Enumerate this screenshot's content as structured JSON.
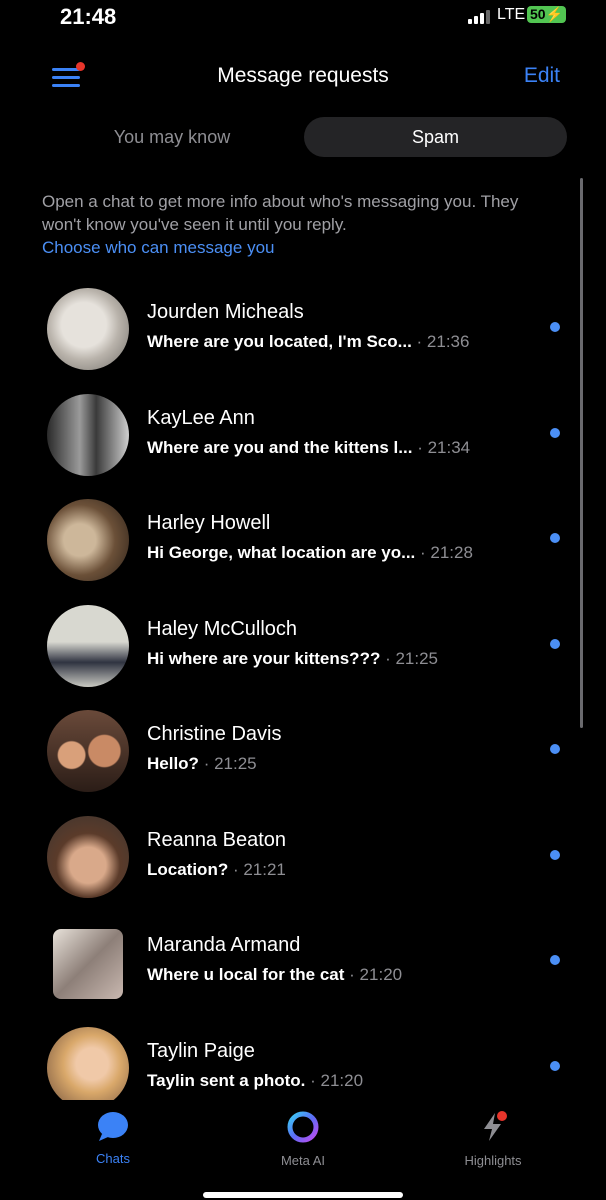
{
  "status": {
    "time": "21:48",
    "network": "LTE",
    "battery": "50"
  },
  "header": {
    "title": "Message requests",
    "edit_label": "Edit"
  },
  "tabs": [
    {
      "label": "You may know",
      "active": false
    },
    {
      "label": "Spam",
      "active": true
    }
  ],
  "info": {
    "text": "Open a chat to get more info about who's messaging you. They won't know you've seen it until you reply.",
    "link": "Choose who can message you"
  },
  "conversations": [
    {
      "name": "Jourden Micheals",
      "preview": "Where are you located, I'm Sco...",
      "time": "· 21:36",
      "unread": true
    },
    {
      "name": "KayLee Ann",
      "preview": "Where are you and the kittens l...",
      "time": "· 21:34",
      "unread": true
    },
    {
      "name": "Harley Howell",
      "preview": "Hi George, what location are yo...",
      "time": "· 21:28",
      "unread": true
    },
    {
      "name": "Haley McCulloch",
      "preview": "Hi where are your kittens???",
      "time": "· 21:25",
      "unread": true
    },
    {
      "name": "Christine Davis",
      "preview": "Hello?",
      "time": "· 21:25",
      "unread": true
    },
    {
      "name": "Reanna Beaton",
      "preview": "Location?",
      "time": "· 21:21",
      "unread": true
    },
    {
      "name": "Maranda Armand",
      "preview": "Where u local for the cat",
      "time": "· 21:20",
      "unread": true
    },
    {
      "name": "Taylin Paige",
      "preview": "Taylin sent a photo.",
      "time": "· 21:20",
      "unread": true
    }
  ],
  "nav": [
    {
      "label": "Chats",
      "icon": "chat-bubble-icon",
      "active": true
    },
    {
      "label": "Meta AI",
      "icon": "meta-ai-ring-icon",
      "active": false
    },
    {
      "label": "Highlights",
      "icon": "lightning-icon",
      "active": false
    }
  ],
  "colors": {
    "accent": "#3b82f6",
    "unread": "#4b8ff5",
    "notification": "#e7352b",
    "battery": "#52c552"
  }
}
